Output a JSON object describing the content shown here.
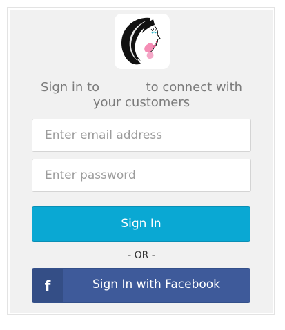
{
  "logo": {
    "icon": "woman-profile-logo-icon"
  },
  "headline": {
    "prefix": "Sign in to",
    "suffix": "to connect with your customers"
  },
  "form": {
    "email_placeholder": "Enter email address",
    "password_placeholder": "Enter password",
    "email_value": "",
    "password_value": ""
  },
  "buttons": {
    "sign_in": "Sign In",
    "separator": "- OR -",
    "facebook_icon": "f",
    "facebook": "Sign In with Facebook"
  },
  "colors": {
    "sign_in_bg": "#0aa8d3",
    "facebook_bg": "#3e5a9a",
    "panel_bg": "#f1f1f1"
  }
}
